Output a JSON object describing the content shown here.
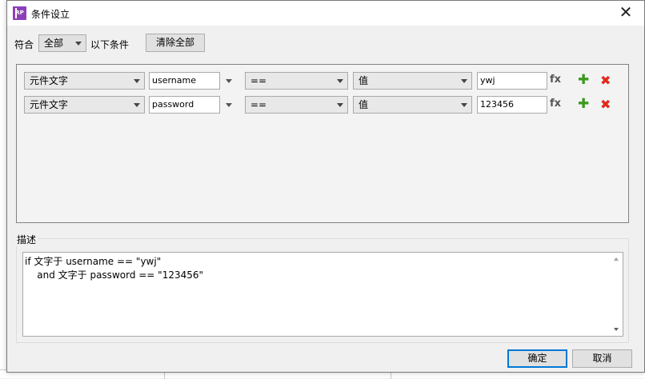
{
  "window": {
    "title": "条件设立",
    "app_icon": "rp-logo-icon",
    "close_symbol": "✕"
  },
  "match": {
    "prefix": "符合",
    "selected": "全部",
    "suffix": "以下条件",
    "clear_label": "清除全部"
  },
  "conditions": [
    {
      "type": "元件文字",
      "target": "username",
      "operator": "==",
      "value_type": "值",
      "value": "ywj"
    },
    {
      "type": "元件文字",
      "target": "password",
      "operator": "==",
      "value_type": "值",
      "value": "123456"
    }
  ],
  "icons": {
    "fx": "fx",
    "add": "✚",
    "remove": "✖"
  },
  "description": {
    "label": "描述",
    "lines": [
      "if 文字于 username == \"ywj\"",
      "    and 文字于 password == \"123456\""
    ]
  },
  "buttons": {
    "ok": "确定",
    "cancel": "取消"
  },
  "colors": {
    "accent": "#0078d7",
    "add": "#3a9a1e",
    "remove": "#e0281a",
    "app_icon": "#8e3fb8"
  }
}
